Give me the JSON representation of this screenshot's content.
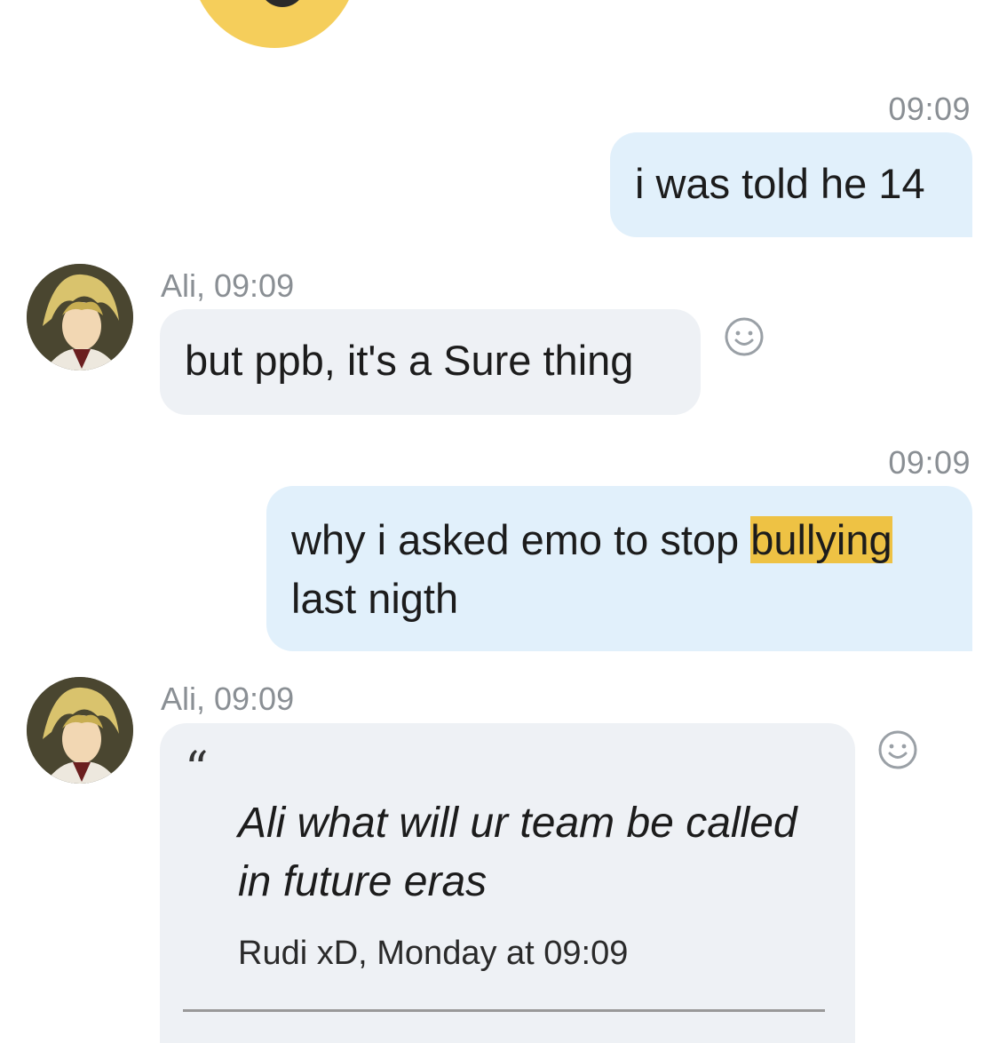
{
  "messages": [
    {
      "direction": "out",
      "time": "09:09",
      "text": "i was told he 14"
    },
    {
      "direction": "in",
      "sender_line": "Ali, 09:09",
      "text": "but ppb, it's a Sure thing"
    },
    {
      "direction": "out",
      "time": "09:09",
      "text_before": "why i asked emo to stop ",
      "highlight": "bullying",
      "text_after": " last nigth"
    },
    {
      "direction": "in",
      "sender_line": "Ali, 09:09",
      "quote": {
        "text": "Ali what will ur team be called in future eras",
        "meta": "Rudi xD, Monday at 09:09"
      }
    }
  ],
  "icons": {
    "emoji": "grinning-emoji-icon",
    "reaction": "smiley-face-icon",
    "quote": "quote-mark-icon"
  },
  "colors": {
    "outgoing_bubble": "#e1f0fb",
    "incoming_bubble": "#eef1f5",
    "highlight": "#eec244",
    "timestamp": "#8a8f94"
  }
}
